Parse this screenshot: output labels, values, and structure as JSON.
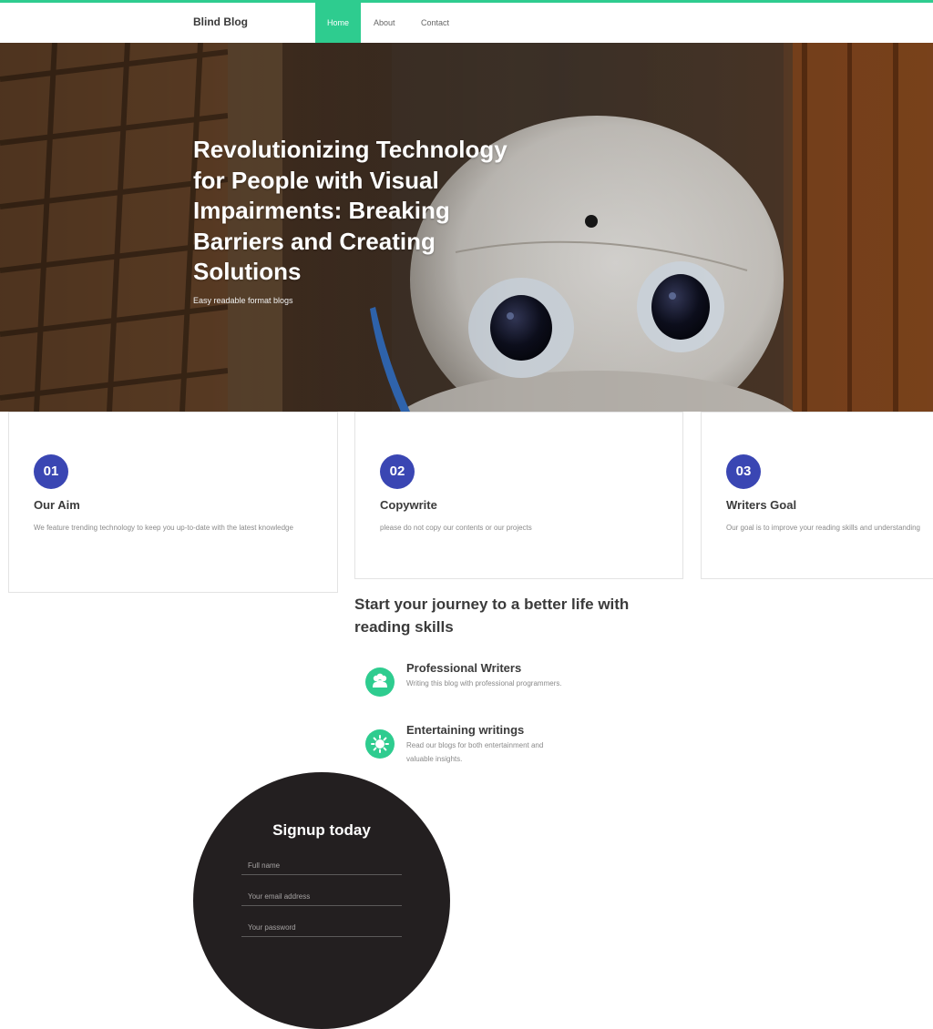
{
  "nav": {
    "brand": "Blind Blog",
    "items": [
      {
        "label": "Home",
        "active": true
      },
      {
        "label": "About",
        "active": false
      },
      {
        "label": "Contact",
        "active": false
      }
    ]
  },
  "hero": {
    "title": "Revolutionizing Technology for People with Visual Impairments: Breaking Barriers and Creating Solutions",
    "subtitle": "Easy readable format blogs"
  },
  "features": [
    {
      "number": "01",
      "title": "Our Aim",
      "text": "We feature trending technology to keep you up-to-date with the latest knowledge"
    },
    {
      "number": "02",
      "title": "Copywrite",
      "text": "please do not copy our contents or our projects"
    },
    {
      "number": "03",
      "title": "Writers Goal",
      "text": "Our goal is to improve your reading skills and understanding"
    }
  ],
  "journey": {
    "title": "Start your journey to a better life with reading skills",
    "items": [
      {
        "icon": "users-icon",
        "title": "Professional Writers",
        "text": "Writing this blog with professional programmers."
      },
      {
        "icon": "sun-icon",
        "title": "Entertaining writings",
        "text": "Read our blogs for both entertainment and valuable insights."
      }
    ]
  },
  "signup": {
    "title": "Signup today",
    "fields": [
      {
        "placeholder": "Full name"
      },
      {
        "placeholder": "Your email address"
      },
      {
        "placeholder": "Your password"
      }
    ]
  },
  "colors": {
    "accent": "#2ecc8f",
    "badge": "#3a46b3",
    "signup_bg": "#231f20"
  }
}
